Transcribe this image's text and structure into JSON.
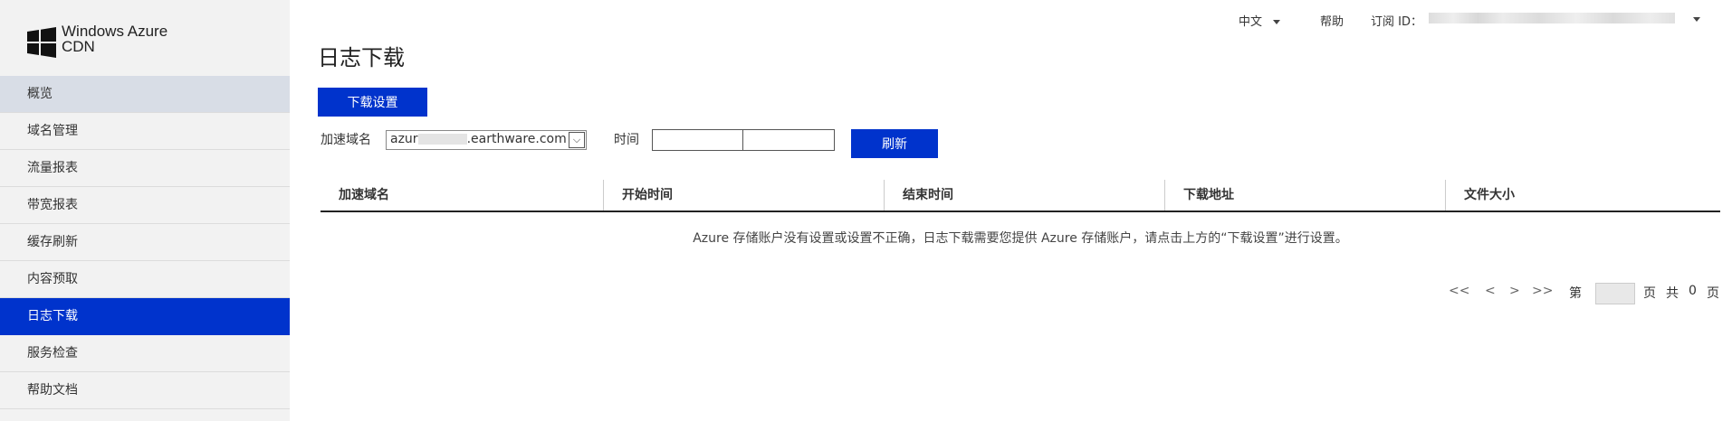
{
  "brand": {
    "line1": "Windows Azure",
    "line2": "CDN",
    "logo_icon": "windows-logo-icon"
  },
  "sidebar": {
    "items": [
      {
        "label": "概览"
      },
      {
        "label": "域名管理"
      },
      {
        "label": "流量报表"
      },
      {
        "label": "带宽报表"
      },
      {
        "label": "缓存刷新"
      },
      {
        "label": "内容预取"
      },
      {
        "label": "日志下载"
      },
      {
        "label": "服务检查"
      },
      {
        "label": "帮助文档"
      }
    ],
    "active_label": "日志下载"
  },
  "topbar": {
    "language": "中文",
    "help": "帮助",
    "subscription_label": "订阅 ID："
  },
  "page": {
    "title": "日志下载",
    "download_settings_button": "下载设置",
    "domain_label": "加速域名",
    "domain_value_prefix": "azur",
    "domain_value_suffix": ".earthware.com",
    "time_label": "时间",
    "refresh_button": "刷新"
  },
  "table": {
    "columns": [
      "加速域名",
      "开始时间",
      "结束时间",
      "下载地址",
      "文件大小"
    ],
    "empty_message": "Azure 存储账户没有设置或设置不正确，日志下载需要您提供 Azure 存储账户，请点击上方的“下载设置”进行设置。"
  },
  "pagination": {
    "first": "<<",
    "prev": "<",
    "next": ">",
    "last": ">>",
    "page_prefix": "第",
    "page_suffix": "页",
    "total_prefix": "共",
    "total_pages": "0",
    "total_suffix": "页"
  },
  "colors": {
    "accent": "#0033cc",
    "sidebar_bg": "#f2f2f2",
    "first_item_bg": "#d8dde6"
  }
}
